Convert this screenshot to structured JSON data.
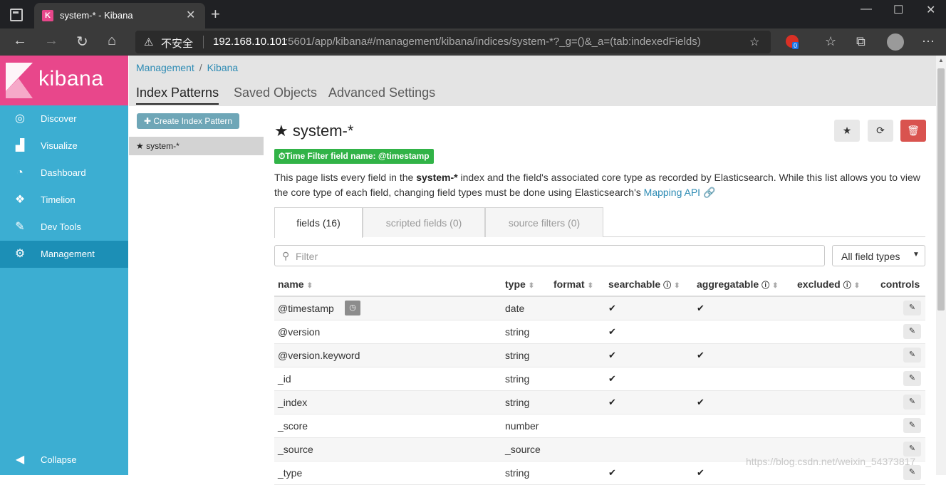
{
  "browser": {
    "tab_title": "system-* - Kibana",
    "favicon_letter": "K",
    "insecure_label": "不安全",
    "url_host": "192.168.10.101",
    "url_rest": ":5601/app/kibana#/management/kibana/indices/system-*?_g=()&_a=(tab:indexedFields)",
    "ext_count": "0"
  },
  "app": {
    "logo_text": "kibana",
    "nav": [
      {
        "label": "Discover",
        "icon": "compass-icon"
      },
      {
        "label": "Visualize",
        "icon": "bar-chart-icon"
      },
      {
        "label": "Dashboard",
        "icon": "dashboard-icon"
      },
      {
        "label": "Timelion",
        "icon": "timelion-icon"
      },
      {
        "label": "Dev Tools",
        "icon": "wrench-icon"
      },
      {
        "label": "Management",
        "icon": "gear-icon"
      }
    ],
    "collapse_label": "Collapse"
  },
  "breadcrumb": {
    "first": "Management",
    "second": "Kibana"
  },
  "subtabs": [
    "Index Patterns",
    "Saved Objects",
    "Advanced Settings"
  ],
  "left_panel": {
    "create_button": "Create Index Pattern",
    "index_pattern": "system-*"
  },
  "page": {
    "title": "system-*",
    "time_filter": "Time Filter field name: @timestamp",
    "desc_before": "This page lists every field in the ",
    "desc_bold": "system-*",
    "desc_after": " index and the field's associated core type as recorded by Elasticsearch. While this list allows you to view the core type of each field, changing field types must be done using Elasticsearch's ",
    "desc_link": "Mapping API"
  },
  "tabs": [
    "fields (16)",
    "scripted fields (0)",
    "source filters (0)"
  ],
  "filter": {
    "placeholder": "Filter",
    "type_select": "All field types"
  },
  "table": {
    "headers": [
      "name",
      "type",
      "format",
      "searchable",
      "aggregatable",
      "excluded",
      "controls"
    ],
    "rows": [
      {
        "name": "@timestamp",
        "type": "date",
        "searchable": "✔",
        "aggregatable": "✔"
      },
      {
        "name": "@version",
        "type": "string",
        "searchable": "✔",
        "aggregatable": ""
      },
      {
        "name": "@version.keyword",
        "type": "string",
        "searchable": "✔",
        "aggregatable": "✔"
      },
      {
        "name": "_id",
        "type": "string",
        "searchable": "✔",
        "aggregatable": ""
      },
      {
        "name": "_index",
        "type": "string",
        "searchable": "✔",
        "aggregatable": "✔"
      },
      {
        "name": "_score",
        "type": "number",
        "searchable": "",
        "aggregatable": ""
      },
      {
        "name": "_source",
        "type": "_source",
        "searchable": "",
        "aggregatable": ""
      },
      {
        "name": "_type",
        "type": "string",
        "searchable": "✔",
        "aggregatable": "✔"
      }
    ]
  },
  "watermark": "https://blog.csdn.net/weixin_54373817",
  "colors": {
    "kibana_pink": "#e8478b",
    "sidebar_blue": "#3caed2",
    "sidebar_active": "#1c8fb6",
    "link_blue": "#2d8bb4",
    "badge_green": "#31b347",
    "danger_red": "#d9534f"
  }
}
